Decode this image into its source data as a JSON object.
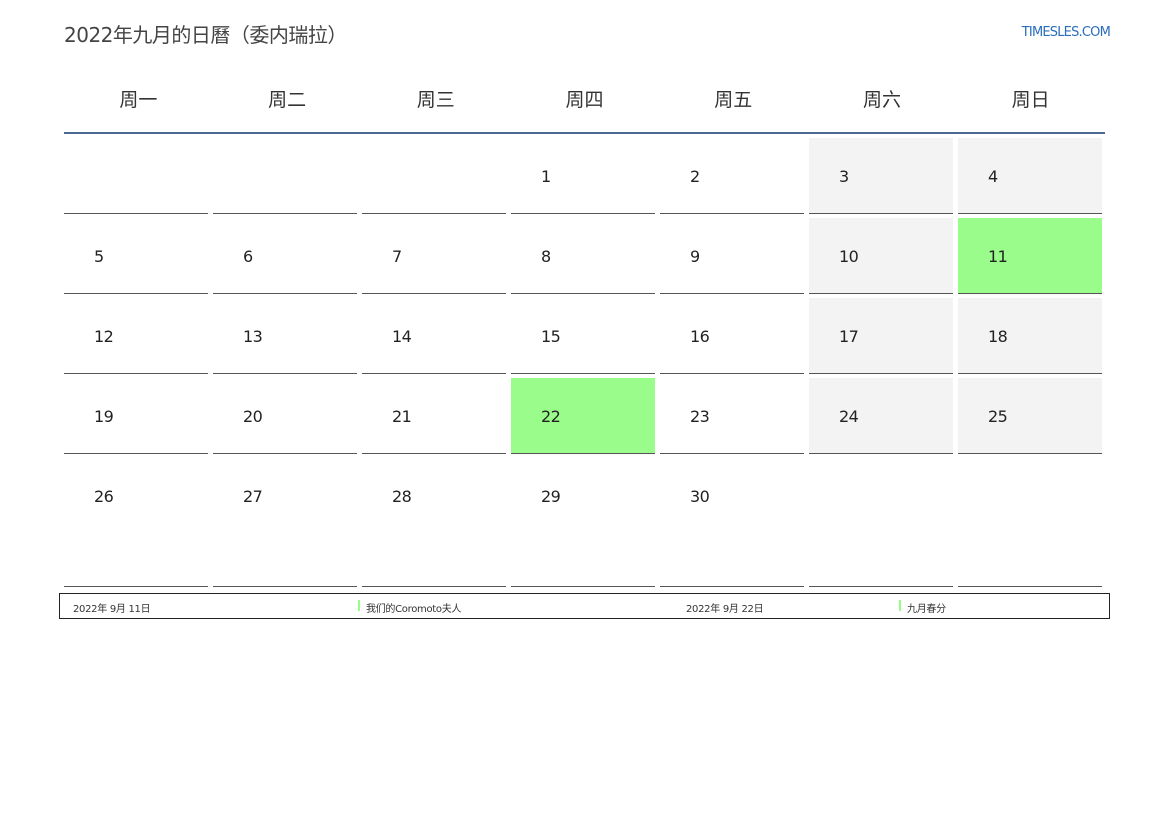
{
  "header": {
    "title": "2022年九月的日曆（委内瑞拉）",
    "site": "TIMESLES.COM"
  },
  "weekdays": [
    "周一",
    "周二",
    "周三",
    "周四",
    "周五",
    "周六",
    "周日"
  ],
  "weeks": [
    [
      "",
      "",
      "",
      "1",
      "2",
      "3",
      "4"
    ],
    [
      "5",
      "6",
      "7",
      "8",
      "9",
      "10",
      "11"
    ],
    [
      "12",
      "13",
      "14",
      "15",
      "16",
      "17",
      "18"
    ],
    [
      "19",
      "20",
      "21",
      "22",
      "23",
      "24",
      "25"
    ],
    [
      "26",
      "27",
      "28",
      "29",
      "30",
      "",
      ""
    ]
  ],
  "highlighted_days": [
    "11",
    "22"
  ],
  "colors": {
    "holiday": "#9afc8a",
    "weekend": "#f3f3f3",
    "header_rule": "#4a6a94",
    "link": "#2a6ebb"
  },
  "legend": [
    {
      "date": "2022年 9月 11日",
      "name": "我们的Coromoto夫人"
    },
    {
      "date": "2022年 9月 22日",
      "name": "九月春分"
    }
  ]
}
